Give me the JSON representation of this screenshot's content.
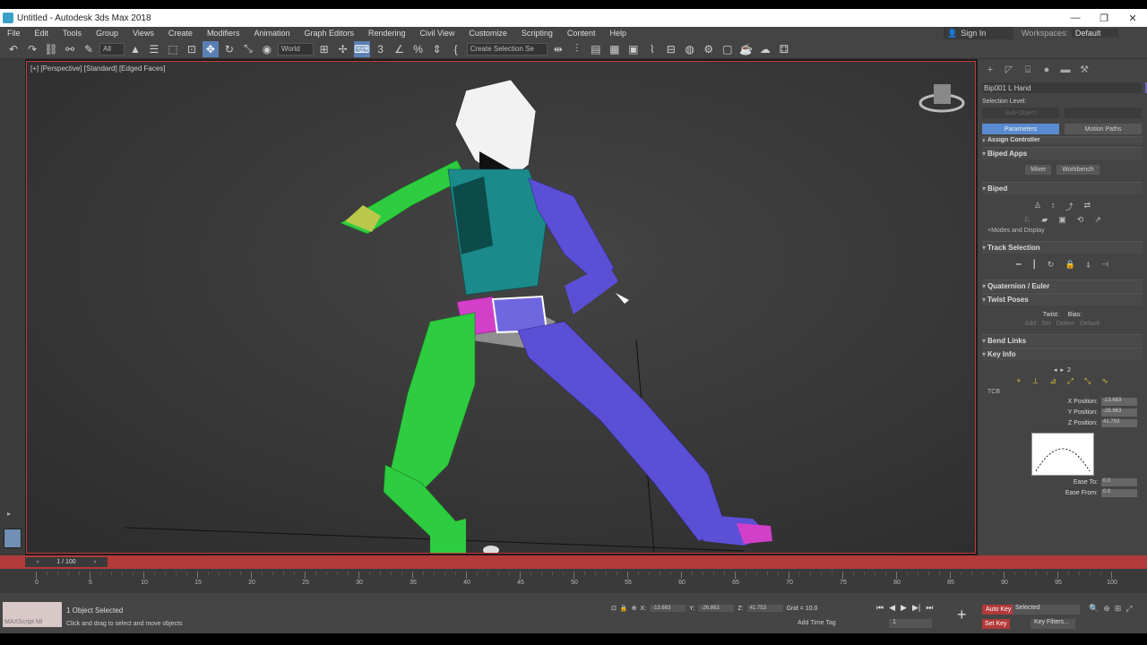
{
  "window": {
    "title": "Untitled - Autodesk 3ds Max 2018",
    "min": "—",
    "max": "❐",
    "close": "✕"
  },
  "menu": [
    "File",
    "Edit",
    "Tools",
    "Group",
    "Views",
    "Create",
    "Modifiers",
    "Animation",
    "Graph Editors",
    "Rendering",
    "Civil View",
    "Customize",
    "Scripting",
    "Content",
    "Help"
  ],
  "signin": "Sign In",
  "workspace": {
    "label": "Workspaces:",
    "value": "Default"
  },
  "toolbar": {
    "filter": "All",
    "coord": "World",
    "selset": "Create Selection Se"
  },
  "viewport": {
    "label": "[+] [Perspective] [Standard] [Edged Faces]"
  },
  "cmd": {
    "object_name": "Bip001 L Hand",
    "selection_level": "Selection Level:",
    "sub_object": "Sub-Object",
    "parameters": "Parameters",
    "motion_paths": "Motion Paths",
    "assign_controller": "Assign Controller",
    "biped_apps": "Biped Apps",
    "mixer": "Mixer",
    "workbench": "Workbench",
    "biped": "Biped",
    "modes_display": "+Modes and Display",
    "track_selection": "Track Selection",
    "quaternion_euler": "Quaternion / Euler",
    "twist_poses": "Twist Poses",
    "twist": "Twist:",
    "bias": "Bias:",
    "add": "Add",
    "set": "Set",
    "delete": "Delete",
    "default": "Default",
    "bend_links": "Bend Links",
    "key_info": "Key Info",
    "key_num": "2",
    "tcb": "TCB",
    "x_pos_label": "X Position:",
    "x_pos": "-13.683",
    "y_pos_label": "Y Position:",
    "y_pos": "-26.863",
    "z_pos_label": "Z Position:",
    "z_pos": "41.793",
    "ease_to_label": "Ease To:",
    "ease_to": "0.0",
    "ease_from_label": "Ease From:",
    "ease_from": "0.0"
  },
  "timeline": {
    "frame": "1 / 100",
    "ticks": [
      "0",
      "5",
      "10",
      "15",
      "20",
      "25",
      "30",
      "35",
      "40",
      "45",
      "50",
      "55",
      "60",
      "65",
      "70",
      "75",
      "80",
      "85",
      "90",
      "95",
      "100"
    ]
  },
  "status": {
    "maxscript": "MAXScript Mi",
    "selected": "1 Object Selected",
    "prompt": "Click and drag to select and move objects",
    "x_label": "X:",
    "x": "-13.683",
    "y_label": "Y:",
    "y": "-26.863",
    "z_label": "Z:",
    "z": "41.753",
    "grid": "Grid = 10.0",
    "add_time_tag": "Add Time Tag",
    "auto_key": "Auto Key",
    "set_key": "Set Key",
    "selected_dd": "Selected",
    "key_filters": "Key Filters...",
    "frame_value": "1"
  }
}
